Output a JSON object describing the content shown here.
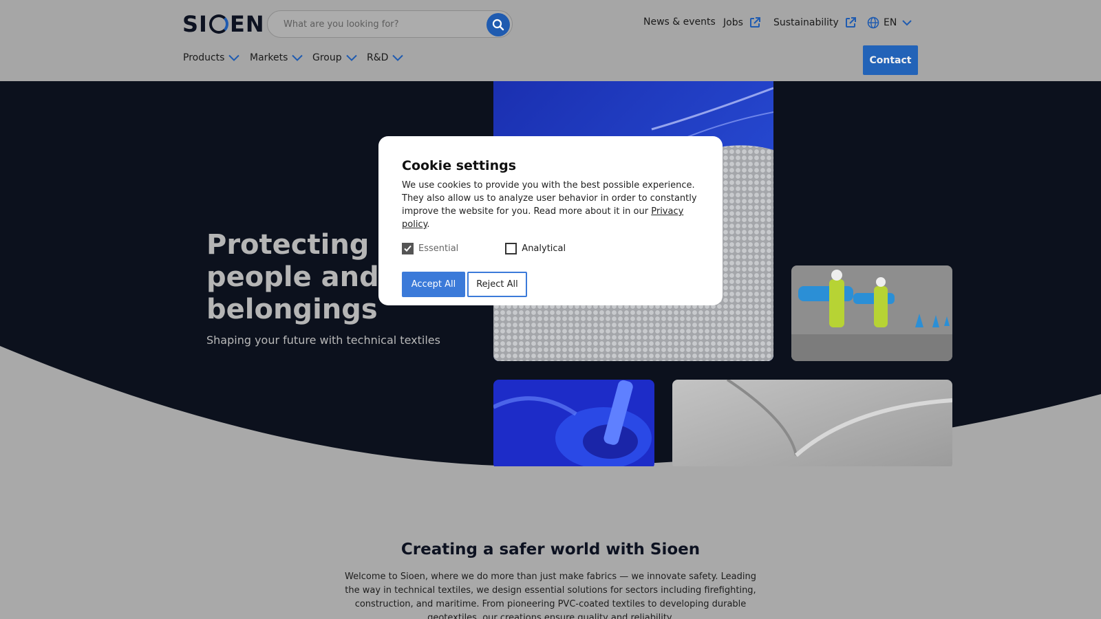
{
  "header": {
    "logo": "SIOEN",
    "search": {
      "placeholder": "What are you looking for?"
    },
    "top_links": [
      "News & events",
      "Jobs",
      "Sustainability"
    ],
    "language": "EN",
    "nav": [
      "Products",
      "Markets",
      "Group",
      "R&D"
    ],
    "contact_label": "Contact"
  },
  "hero": {
    "title_line1": "Protecting",
    "title_line2": "people and t",
    "title_line3": "belongings",
    "subtitle": "Shaping your future with technical textiles"
  },
  "intro": {
    "title": "Creating a safer world with Sioen",
    "text": "Welcome to Sioen, where we do more than just make fabrics — we innovate safety. Leading the way in technical textiles, we design essential solutions for sectors including firefighting, construction, and maritime. From pioneering PVC-coated textiles to developing durable geotextiles, our creations ensure quality and reliability."
  },
  "cookie_modal": {
    "title": "Cookie settings",
    "text": "We use cookies to provide you with the best possible experience. They also allow us to analyze user behavior in order to constantly improve the website for you. Read more about it in our",
    "privacy_link": "Privacy policy",
    "essential_label": "Essential",
    "analytical_label": "Analytical",
    "accept_label": "Accept All",
    "reject_label": "Reject All"
  },
  "colors": {
    "brand_blue": "#2263b8",
    "dark_navy": "#0d1221",
    "accept_blue": "#3b7ad9"
  }
}
